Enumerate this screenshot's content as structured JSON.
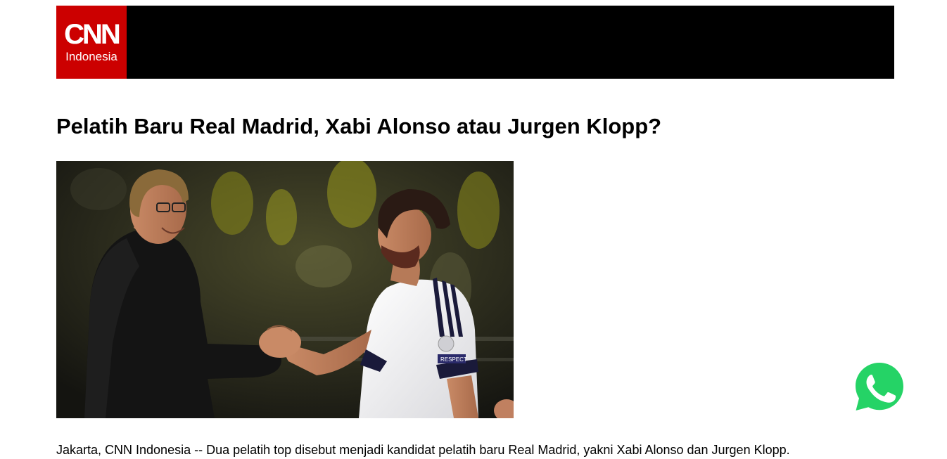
{
  "header": {
    "logo_main": "CNN",
    "logo_sub": "Indonesia",
    "brand_color": "#cc0000",
    "bar_color": "#000000"
  },
  "article": {
    "title": "Pelatih Baru Real Madrid, Xabi Alonso atau Jurgen Klopp?",
    "photo_badge_text": "RESPECT",
    "lead": "Jakarta, CNN Indonesia -- Dua pelatih top disebut menjadi kandidat pelatih baru Real Madrid, yakni Xabi Alonso dan Jurgen Klopp."
  },
  "floating": {
    "share_icon": "whatsapp-icon",
    "share_color": "#25d366"
  }
}
